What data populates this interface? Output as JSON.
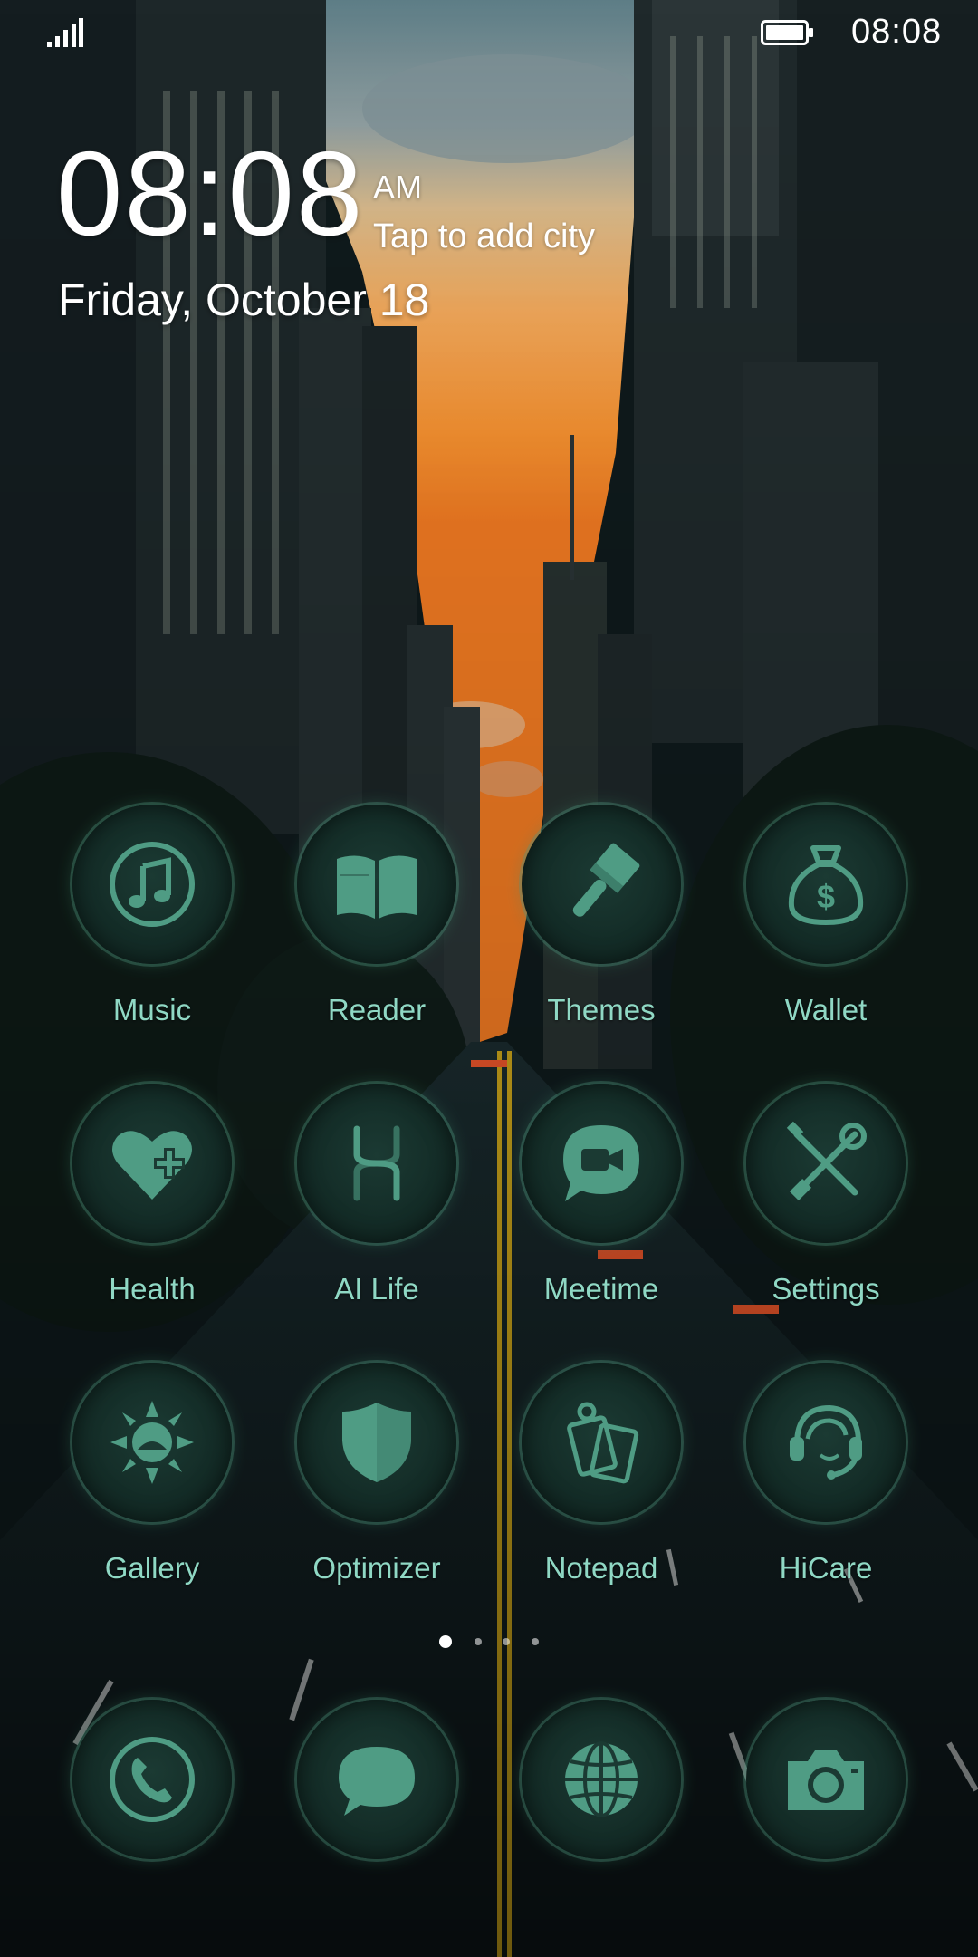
{
  "status_bar": {
    "time": "08:08",
    "signal_icon": "signal-bars-icon",
    "battery_icon": "battery-icon"
  },
  "clock_widget": {
    "time": "08:08",
    "ampm": "AM",
    "city_prompt": "Tap to add city",
    "date": "Friday, October 18"
  },
  "apps": [
    {
      "label": "Music",
      "icon": "music-note-icon"
    },
    {
      "label": "Reader",
      "icon": "open-book-icon"
    },
    {
      "label": "Themes",
      "icon": "paintbrush-icon"
    },
    {
      "label": "Wallet",
      "icon": "money-bag-icon"
    },
    {
      "label": "Health",
      "icon": "heart-plus-icon"
    },
    {
      "label": "AI Life",
      "icon": "ai-life-icon"
    },
    {
      "label": "Meetime",
      "icon": "video-chat-icon"
    },
    {
      "label": "Settings",
      "icon": "tools-icon"
    },
    {
      "label": "Gallery",
      "icon": "sun-icon"
    },
    {
      "label": "Optimizer",
      "icon": "shield-icon"
    },
    {
      "label": "Notepad",
      "icon": "notepad-icon"
    },
    {
      "label": "HiCare",
      "icon": "headset-support-icon"
    }
  ],
  "dock": [
    {
      "name": "Phone",
      "icon": "phone-icon"
    },
    {
      "name": "Messages",
      "icon": "message-bubble-icon"
    },
    {
      "name": "Browser",
      "icon": "globe-icon"
    },
    {
      "name": "Camera",
      "icon": "camera-icon"
    }
  ],
  "page_indicator": {
    "pages": 4,
    "current": 1
  },
  "colors": {
    "icon_glyph": "#4f9c84",
    "label_text": "#8fd8c4",
    "icon_ring": "#50967d"
  }
}
